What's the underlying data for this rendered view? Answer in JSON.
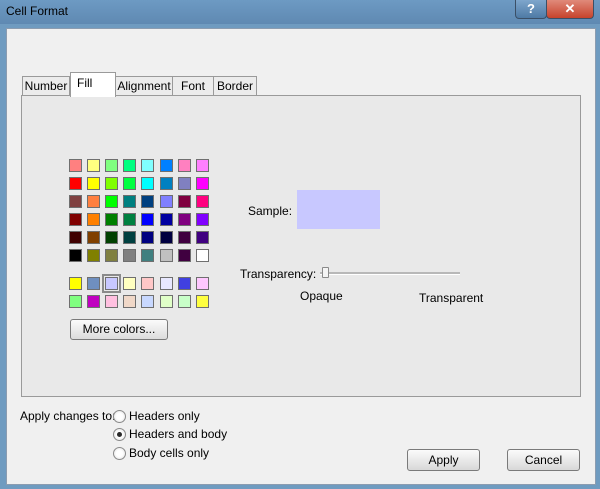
{
  "window": {
    "title": "Cell Format",
    "help_glyph": "?",
    "close_glyph": "✕"
  },
  "tabs": [
    {
      "label": "Number"
    },
    {
      "label": "Fill"
    },
    {
      "label": "Alignment"
    },
    {
      "label": "Font"
    },
    {
      "label": "Border"
    }
  ],
  "active_tab": "Fill",
  "palette": {
    "main_rows": [
      [
        "#ff8080",
        "#ffff80",
        "#80ff80",
        "#00ff80",
        "#80ffff",
        "#0080ff",
        "#ff80c0",
        "#ff80ff"
      ],
      [
        "#ff0000",
        "#ffff00",
        "#80ff00",
        "#00ff40",
        "#00ffff",
        "#0080c0",
        "#8080c0",
        "#ff00ff"
      ],
      [
        "#804040",
        "#ff8040",
        "#00ff00",
        "#008080",
        "#004080",
        "#8080ff",
        "#800040",
        "#ff0080"
      ],
      [
        "#800000",
        "#ff8000",
        "#008000",
        "#008040",
        "#0000ff",
        "#0000a0",
        "#800080",
        "#8000ff"
      ],
      [
        "#400000",
        "#804000",
        "#004000",
        "#004040",
        "#000080",
        "#000040",
        "#400040",
        "#400080"
      ],
      [
        "#000000",
        "#808000",
        "#808040",
        "#808080",
        "#408080",
        "#c0c0c0",
        "#400040",
        "#ffffff"
      ]
    ],
    "custom_rows": [
      [
        "#ffff00",
        "#6f8fbf",
        "#c8c8ff",
        "#ffffc0",
        "#ffc8c8",
        "#e8e8ff",
        "#4040e0",
        "#ffc8ff"
      ],
      [
        "#80ff80",
        "#c000c0",
        "#ffc0e0",
        "#f0d8c8",
        "#c8d8ff",
        "#e0ffc8",
        "#c8ffc8",
        "#ffff40"
      ]
    ],
    "selected": "#c8c8ff"
  },
  "more_colors_label": "More colors...",
  "sample": {
    "label": "Sample:",
    "color": "#c8c8ff"
  },
  "transparency": {
    "label": "Transparency:",
    "value": 0,
    "min_label": "Opaque",
    "max_label": "Transparent"
  },
  "apply_to": {
    "label": "Apply changes to:",
    "options": [
      {
        "label": "Headers only",
        "checked": false
      },
      {
        "label": "Headers and body",
        "checked": true
      },
      {
        "label": "Body cells only",
        "checked": false
      }
    ]
  },
  "buttons": {
    "apply": "Apply",
    "cancel": "Cancel"
  }
}
